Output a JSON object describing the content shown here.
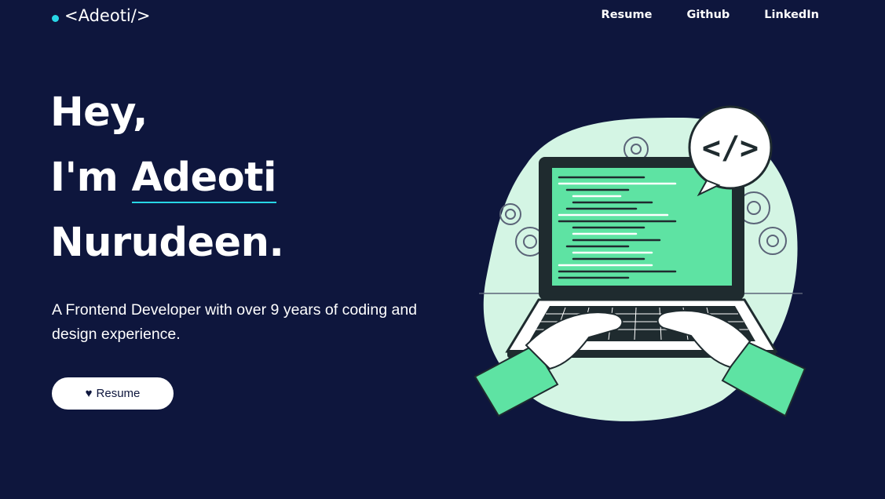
{
  "header": {
    "logo_text": "<Adeoti/>",
    "nav": [
      {
        "label": "Resume"
      },
      {
        "label": "Github"
      },
      {
        "label": "LinkedIn"
      }
    ]
  },
  "hero": {
    "line1": "Hey,",
    "line2_prefix": "I'm ",
    "line2_name": "Adeoti",
    "line3": "Nurudeen.",
    "subtitle": "A Frontend Developer with over 9 years of coding and design experience.",
    "cta_icon": "♥",
    "cta_label": "Resume"
  },
  "illustration": {
    "code_badge": "</>",
    "icon": "developer-laptop-illustration",
    "colors": {
      "blob": "#d4f5e4",
      "screen": "#5ee3a3",
      "frame": "#1f2b2f",
      "sleeve": "#5ee3a3"
    }
  },
  "colors": {
    "background": "#0e163d",
    "accent": "#28d6e6",
    "text": "#ffffff"
  }
}
